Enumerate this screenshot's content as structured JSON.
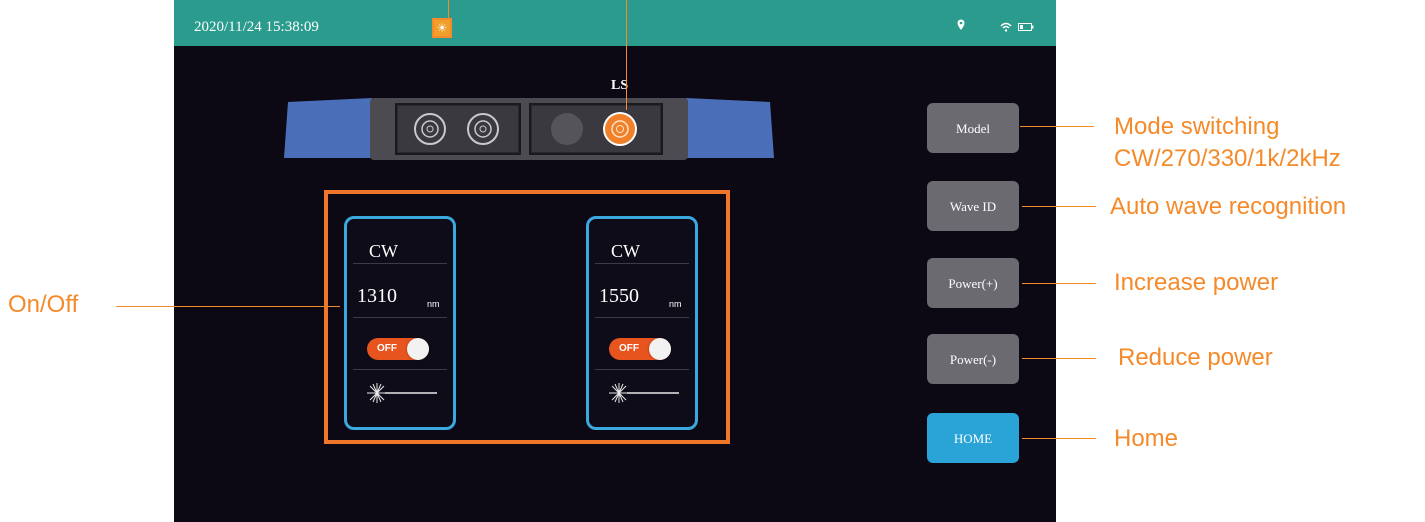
{
  "status_bar": {
    "datetime": "2020/11/24 15:38:09",
    "icons": [
      "sun-icon",
      "location-icon",
      "wifi-icon",
      "battery-icon"
    ]
  },
  "connector": {
    "label": "LS"
  },
  "channels": [
    {
      "mode": "CW",
      "wavelength": "1310",
      "unit": "nm",
      "toggle": "OFF",
      "icon": "laser-icon"
    },
    {
      "mode": "CW",
      "wavelength": "1550",
      "unit": "nm",
      "toggle": "OFF",
      "icon": "laser-icon"
    }
  ],
  "buttons": {
    "model": "Model",
    "wave_id": "Wave ID",
    "power_plus": "Power(+)",
    "power_minus": "Power(-)",
    "home": "HOME"
  },
  "callouts": {
    "mode_line1": "Mode switching",
    "mode_line2": "CW/270/330/1k/2kHz",
    "wave": "Auto wave recognition",
    "power_plus": "Increase power",
    "power_minus": "Reduce power",
    "home": "Home",
    "onoff": "On/Off"
  },
  "colors": {
    "accent": "#f58a2a",
    "status_bar": "#2a9b8c",
    "channel_border": "#3ca8e0",
    "home_button": "#2aa4d6",
    "button": "#6b6a70",
    "background": "#0c0914"
  }
}
